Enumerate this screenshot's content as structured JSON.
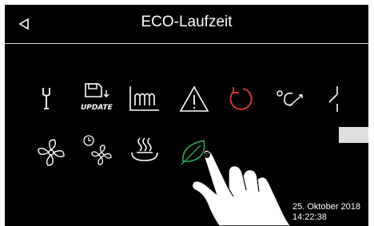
{
  "header": {
    "title": "ECO-Laufzeit",
    "back_icon": "back-triangle-icon"
  },
  "icons_row1": [
    {
      "name": "wrench-icon"
    },
    {
      "name": "update-icon",
      "label": "UPDATE"
    },
    {
      "name": "heating-curve-icon"
    },
    {
      "name": "warning-icon"
    },
    {
      "name": "reset-icon",
      "color": "#e23a3a"
    },
    {
      "name": "temperature-icon"
    },
    {
      "name": "switch-icon"
    }
  ],
  "icons_row2": [
    {
      "name": "fan-icon"
    },
    {
      "name": "fan-timer-icon"
    },
    {
      "name": "hot-water-icon"
    },
    {
      "name": "eco-leaf-icon",
      "color": "#2fa84f"
    }
  ],
  "footer": {
    "date": "25. Oktober 2018",
    "time": "14:22:38"
  },
  "colors": {
    "background": "#000000",
    "foreground": "#ffffff",
    "accent_red": "#e23a3a",
    "accent_green": "#2fa84f"
  }
}
